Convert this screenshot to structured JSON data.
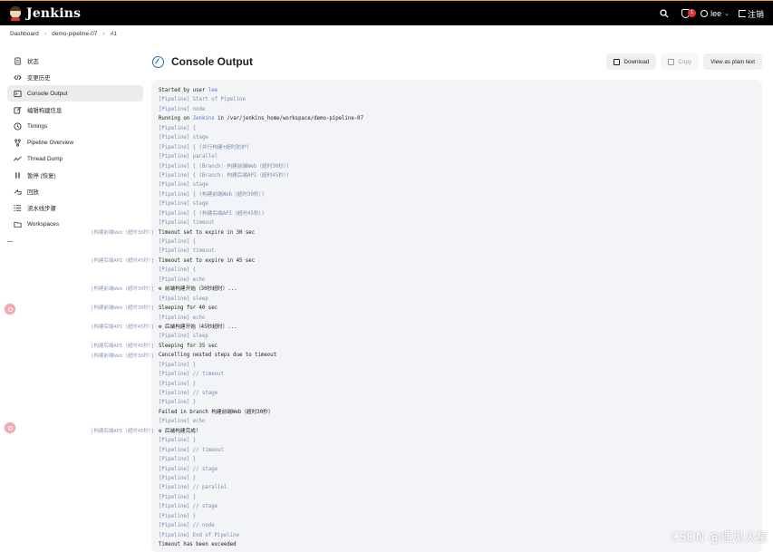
{
  "app": {
    "name": "Jenkins"
  },
  "topbar": {
    "security_badge": "1",
    "user": "lee",
    "logout_label": "注销"
  },
  "breadcrumb": [
    "Dashboard",
    "demo-pipeline-07",
    "#1"
  ],
  "sidebar": {
    "items": [
      {
        "label": "状态",
        "icon": "document-icon"
      },
      {
        "label": "变更历史",
        "icon": "code-icon"
      },
      {
        "label": "Console Output",
        "icon": "terminal-icon",
        "active": true
      },
      {
        "label": "编辑构建信息",
        "icon": "edit-icon"
      },
      {
        "label": "Timings",
        "icon": "clock-icon"
      },
      {
        "label": "Pipeline Overview",
        "icon": "pipeline-icon"
      },
      {
        "label": "Thread Dump",
        "icon": "activity-icon"
      },
      {
        "label": "暂停 (恢复)",
        "icon": "pause-icon"
      },
      {
        "label": "回放",
        "icon": "replay-icon"
      },
      {
        "label": "流水线步骤",
        "icon": "list-icon"
      },
      {
        "label": "Workspaces",
        "icon": "folder-icon"
      }
    ]
  },
  "main": {
    "title": "Console Output",
    "buttons": {
      "download": "Download",
      "copy": "Copy",
      "plain": "View as plain text"
    }
  },
  "console": {
    "lines": [
      {
        "prefix": "",
        "text": "Started by user ",
        "link": "lee",
        "pl": false
      },
      {
        "prefix": "",
        "text": "[Pipeline] Start of Pipeline",
        "pl": true
      },
      {
        "prefix": "",
        "text": "[Pipeline] node",
        "pl": true
      },
      {
        "prefix": "",
        "text": "Running on ",
        "link": "Jenkins",
        "rest": " in /var/jenkins_home/workspace/demo-pipeline-07",
        "pl": false
      },
      {
        "prefix": "",
        "text": "[Pipeline] {",
        "pl": true
      },
      {
        "prefix": "",
        "text": "[Pipeline] stage",
        "pl": true
      },
      {
        "prefix": "",
        "text": "[Pipeline] { (并行构建+超时防护)",
        "pl": true
      },
      {
        "prefix": "",
        "text": "[Pipeline] parallel",
        "pl": true
      },
      {
        "prefix": "",
        "text": "[Pipeline] { (Branch: 构建前端Web（超时30秒）)",
        "pl": true
      },
      {
        "prefix": "",
        "text": "[Pipeline] { (Branch: 构建后端API（超时45秒）)",
        "pl": true
      },
      {
        "prefix": "",
        "text": "[Pipeline] stage",
        "pl": true
      },
      {
        "prefix": "",
        "text": "[Pipeline] { (构建前端Web（超时30秒）)",
        "pl": true
      },
      {
        "prefix": "",
        "text": "[Pipeline] stage",
        "pl": true
      },
      {
        "prefix": "",
        "text": "[Pipeline] { (构建后端API（超时45秒）)",
        "pl": true
      },
      {
        "prefix": "",
        "text": "[Pipeline] timeout",
        "pl": true
      },
      {
        "prefix": "[构建前端Web（超时30秒）]",
        "text": "Timeout set to expire in 30 sec",
        "pl": false
      },
      {
        "prefix": "",
        "text": "[Pipeline] {",
        "pl": true
      },
      {
        "prefix": "",
        "text": "[Pipeline] timeout",
        "pl": true
      },
      {
        "prefix": "[构建后端API（超时45秒）]",
        "text": "Timeout set to expire in 45 sec",
        "pl": false
      },
      {
        "prefix": "",
        "text": "[Pipeline] {",
        "pl": true
      },
      {
        "prefix": "",
        "text": "[Pipeline] echo",
        "pl": true
      },
      {
        "prefix": "[构建前端Web（超时30秒）]",
        "text": "⚙ 前端构建开始（30秒超时）...",
        "pl": false
      },
      {
        "prefix": "",
        "text": "[Pipeline] sleep",
        "pl": true
      },
      {
        "prefix": "[构建前端Web（超时30秒）]",
        "text": "Sleeping for 40 sec",
        "pl": false
      },
      {
        "prefix": "",
        "text": "[Pipeline] echo",
        "pl": true
      },
      {
        "prefix": "[构建后端API（超时45秒）]",
        "text": "⚙ 后端构建开始（45秒超时）...",
        "pl": false
      },
      {
        "prefix": "",
        "text": "[Pipeline] sleep",
        "pl": true
      },
      {
        "prefix": "[构建后端API（超时45秒）]",
        "text": "Sleeping for 35 sec",
        "pl": false
      },
      {
        "prefix": "[构建前端Web（超时30秒）]",
        "text": "Cancelling nested steps due to timeout",
        "pl": false
      },
      {
        "prefix": "",
        "text": "[Pipeline] }",
        "pl": true
      },
      {
        "prefix": "",
        "text": "[Pipeline] // timeout",
        "pl": true
      },
      {
        "prefix": "",
        "text": "[Pipeline] }",
        "pl": true
      },
      {
        "prefix": "",
        "text": "[Pipeline] // stage",
        "pl": true
      },
      {
        "prefix": "",
        "text": "[Pipeline] }",
        "pl": true
      },
      {
        "prefix": "",
        "text": "Failed in branch 构建前端Web（超时30秒）",
        "pl": false
      },
      {
        "prefix": "",
        "text": "[Pipeline] echo",
        "pl": true
      },
      {
        "prefix": "[构建后端API（超时45秒）]",
        "text": "⚙ 后端构建完成!",
        "pl": false
      },
      {
        "prefix": "",
        "text": "[Pipeline] }",
        "pl": true
      },
      {
        "prefix": "",
        "text": "[Pipeline] // timeout",
        "pl": true
      },
      {
        "prefix": "",
        "text": "[Pipeline] }",
        "pl": true
      },
      {
        "prefix": "",
        "text": "[Pipeline] // stage",
        "pl": true
      },
      {
        "prefix": "",
        "text": "[Pipeline] }",
        "pl": true
      },
      {
        "prefix": "",
        "text": "[Pipeline] // parallel",
        "pl": true
      },
      {
        "prefix": "",
        "text": "[Pipeline] }",
        "pl": true
      },
      {
        "prefix": "",
        "text": "[Pipeline] // stage",
        "pl": true
      },
      {
        "prefix": "",
        "text": "[Pipeline] }",
        "pl": true
      },
      {
        "prefix": "",
        "text": "[Pipeline] // node",
        "pl": true
      },
      {
        "prefix": "",
        "text": "[Pipeline] End of Pipeline",
        "pl": true
      },
      {
        "prefix": "",
        "text": "Timeout has been exceeded",
        "pl": false
      }
    ]
  },
  "watermark": "CSDN @遇见火星",
  "colors": {
    "topbar": "#000000",
    "accent": "#e8a317",
    "link": "#4a7cc8",
    "pipeline_text": "#7b8fb2",
    "console_bg": "#f3f4f7"
  }
}
